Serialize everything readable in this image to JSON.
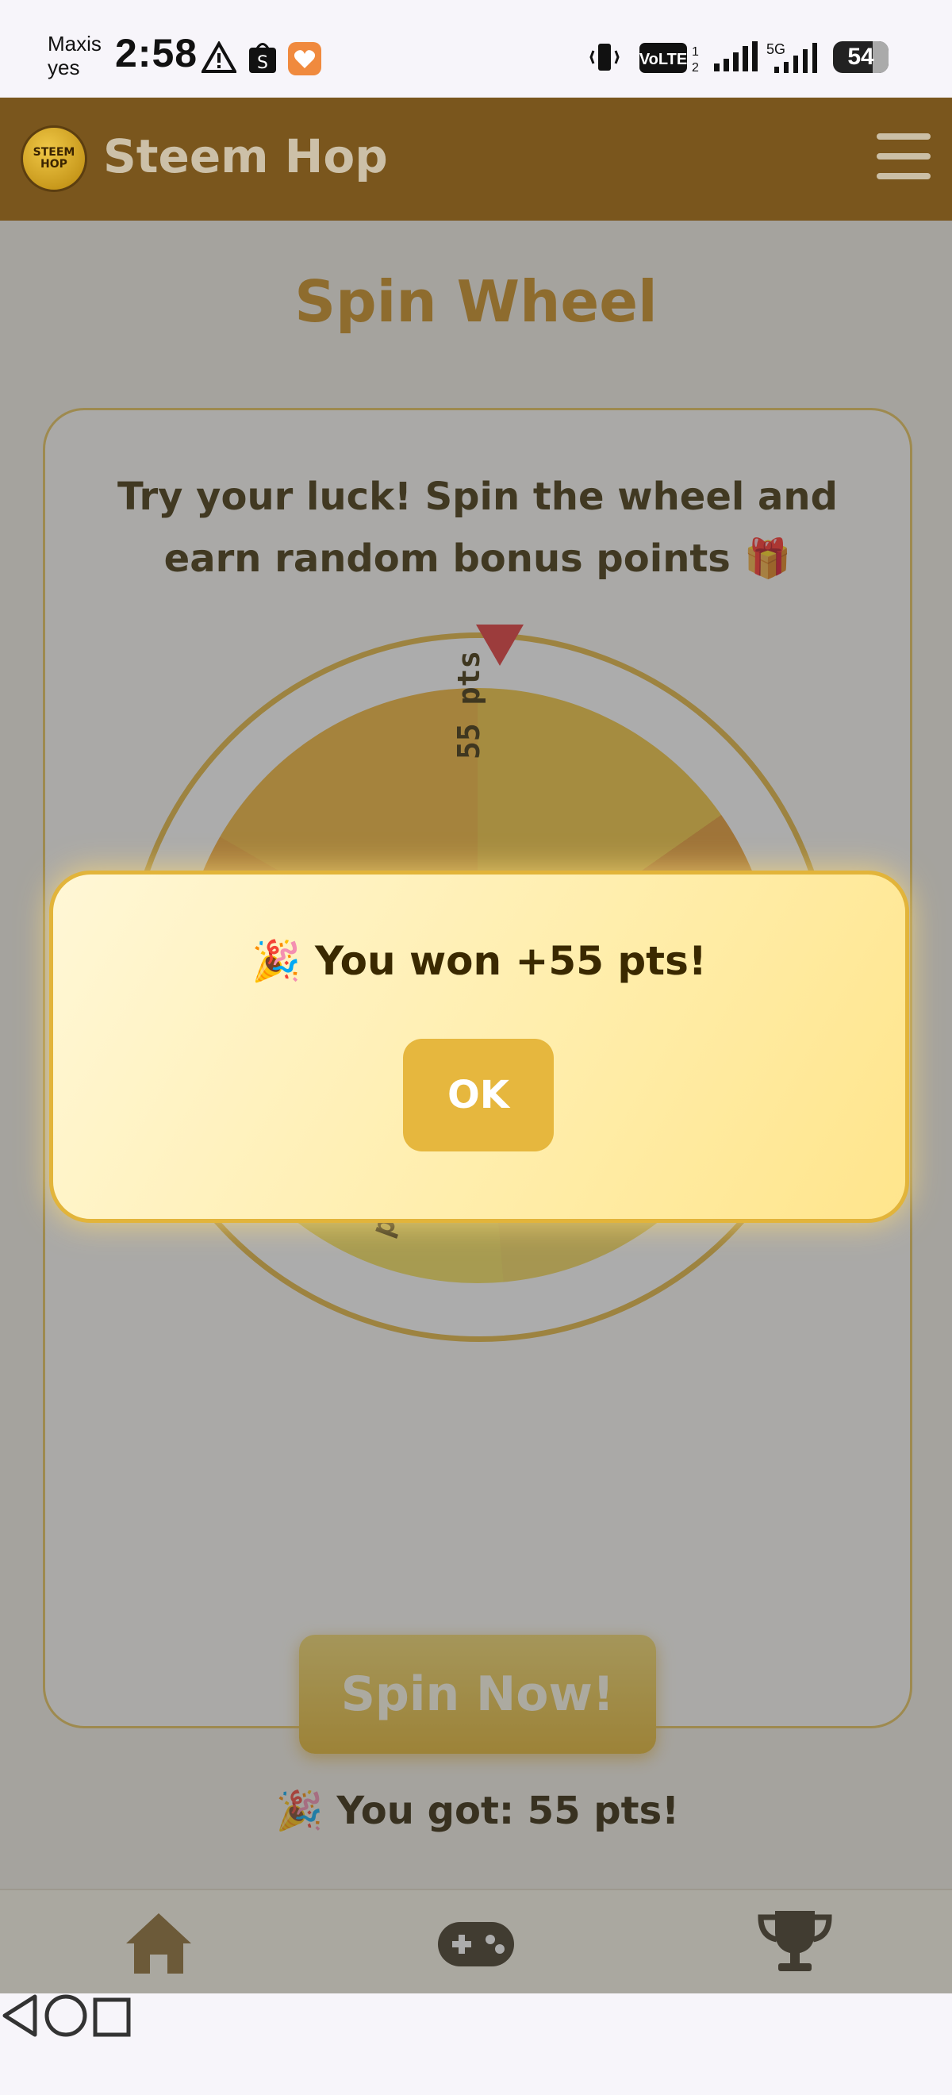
{
  "status_bar": {
    "carrier_line1": "Maxis",
    "carrier_line2": "yes",
    "time": "2:58",
    "battery": "54",
    "icons": [
      "warning-icon",
      "shopee-icon",
      "heart-app-icon",
      "vibrate-icon",
      "volte-icon",
      "signal-icon",
      "5g-signal-icon",
      "battery-icon"
    ]
  },
  "header": {
    "logo_text": "STEEM HOP",
    "title": "Steem Hop",
    "menu_icon": "hamburger-menu-icon"
  },
  "page": {
    "title": "Spin Wheel",
    "description": "Try your luck! Spin the wheel and earn random bonus points 🎁",
    "wheel_visible_labels": [
      "55 pts",
      "pts",
      "s"
    ],
    "spin_button": "Spin Now!",
    "result": "🎉 You got: 55 pts!"
  },
  "modal": {
    "message": "🎉 You won +55 pts!",
    "ok_button": "OK"
  },
  "bottom_nav": {
    "items": [
      "home-icon",
      "gamepad-icon",
      "trophy-icon"
    ]
  },
  "system_nav": [
    "back-icon",
    "home-circle-icon",
    "recents-icon"
  ],
  "colors": {
    "header_bg": "#7a561d",
    "accent": "#e6b73e",
    "title": "#c98a1a",
    "pointer": "#e23333"
  }
}
